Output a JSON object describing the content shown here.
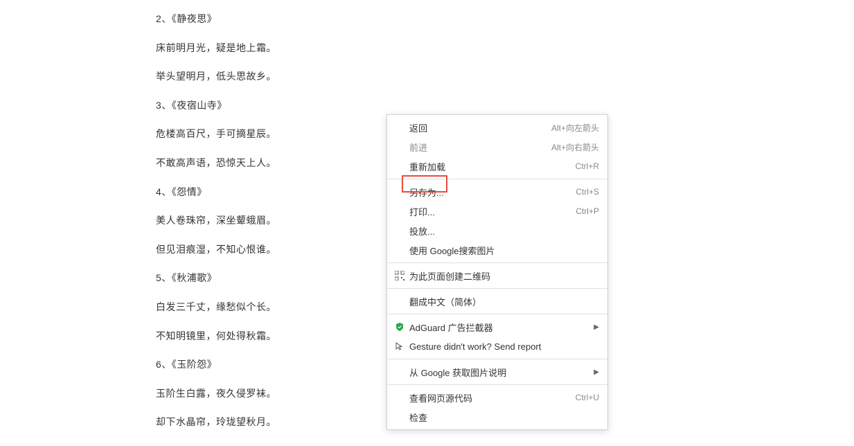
{
  "content": {
    "lines": [
      "2、《静夜思》",
      "床前明月光，疑是地上霜。",
      "举头望明月，低头思故乡。",
      "3、《夜宿山寺》",
      "危楼高百尺，手可摘星辰。",
      "不敢高声语，恐惊天上人。",
      "4、《怨情》",
      "美人卷珠帘，深坐颦蛾眉。",
      "但见泪痕湿，不知心恨谁。",
      "5、《秋浦歌》",
      "白发三千丈，缘愁似个长。",
      "不知明镜里，何处得秋霜。",
      "6、《玉阶怨》",
      "玉阶生白露，夜久侵罗袜。",
      "却下水晶帘，玲珑望秋月。"
    ]
  },
  "menu": {
    "back": {
      "label": "返回",
      "shortcut": "Alt+向左箭头"
    },
    "forward": {
      "label": "前进",
      "shortcut": "Alt+向右箭头"
    },
    "reload": {
      "label": "重新加载",
      "shortcut": "Ctrl+R"
    },
    "saveAs": {
      "label": "另存为...",
      "shortcut": "Ctrl+S"
    },
    "print": {
      "label": "打印...",
      "shortcut": "Ctrl+P"
    },
    "cast": {
      "label": "投放..."
    },
    "searchImage": {
      "label": "使用 Google搜索图片"
    },
    "qrcode": {
      "label": "为此页面创建二维码"
    },
    "translate": {
      "label": "翻成中文（简体）"
    },
    "adguard": {
      "label": "AdGuard 广告拦截器"
    },
    "gesture": {
      "label": "Gesture didn't work? Send report"
    },
    "imageDesc": {
      "label": "从 Google 获取图片说明"
    },
    "viewSource": {
      "label": "查看网页源代码",
      "shortcut": "Ctrl+U"
    },
    "inspect": {
      "label": "检查"
    }
  }
}
